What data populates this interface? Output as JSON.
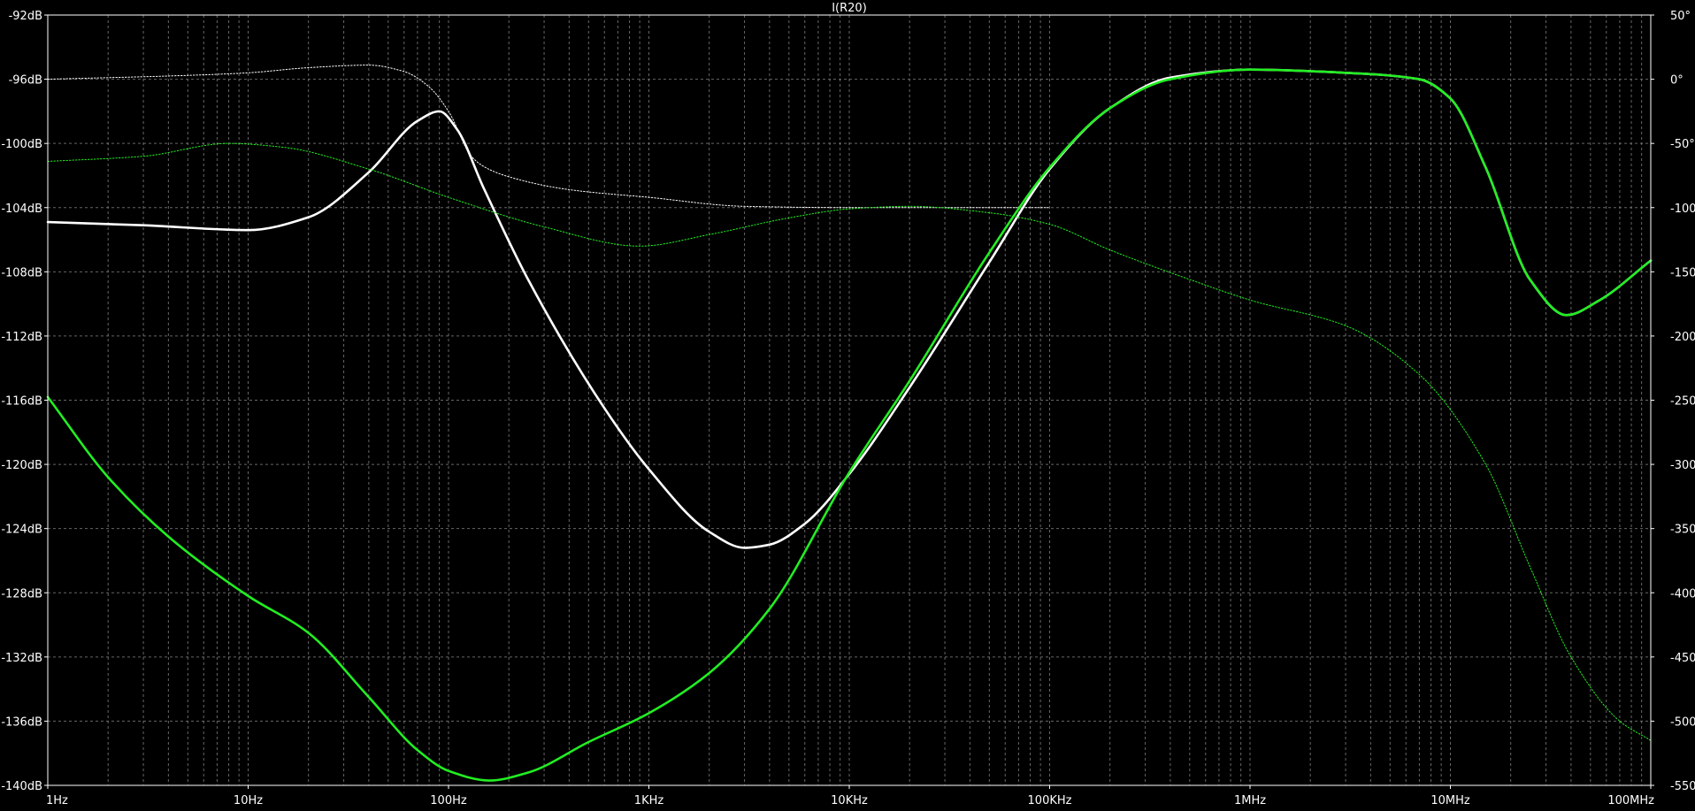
{
  "chart_data": {
    "type": "line",
    "title": "I(R20)",
    "x_scale": "log",
    "x_range_hz": [
      1,
      100000000
    ],
    "x_tick_labels": [
      "1Hz",
      "10Hz",
      "100Hz",
      "1KHz",
      "10KHz",
      "100KHz",
      "1MHz",
      "10MHz",
      "100MHz"
    ],
    "y_left_range_db": [
      -140,
      -92
    ],
    "y_left_tick_labels": [
      "-92dB",
      "-96dB",
      "-100dB",
      "-104dB",
      "-108dB",
      "-112dB",
      "-116dB",
      "-120dB",
      "-124dB",
      "-128dB",
      "-132dB",
      "-136dB",
      "-140dB"
    ],
    "y_right_range_deg": [
      -550,
      50
    ],
    "y_right_tick_labels": [
      "50°",
      "0°",
      "-50°",
      "-100°",
      "-150°",
      "-200°",
      "-250°",
      "-300°",
      "-350°",
      "-400°",
      "-450°",
      "-500°",
      "-550°"
    ],
    "grid": true,
    "colors": {
      "background": "#000000",
      "axis": "#ffffff",
      "grid": "#8a8a8a",
      "white_trace": "#ffffff",
      "green_trace": "#22ee22"
    },
    "series": [
      {
        "color": "#ffffff",
        "style": "solid",
        "axis": "left",
        "unit": "dB",
        "points": [
          [
            1,
            -104.9
          ],
          [
            3,
            -105.1
          ],
          [
            10,
            -105.4
          ],
          [
            20,
            -104.6
          ],
          [
            40,
            -101.8
          ],
          [
            70,
            -98.6
          ],
          [
            90,
            -98.0
          ],
          [
            110,
            -99.1
          ],
          [
            150,
            -102.8
          ],
          [
            250,
            -108.5
          ],
          [
            600,
            -116.5
          ],
          [
            1000,
            -120.3
          ],
          [
            2000,
            -124.2
          ],
          [
            3000,
            -125.2
          ],
          [
            4000,
            -125.0
          ],
          [
            6000,
            -123.7
          ],
          [
            10000,
            -120.6
          ],
          [
            20000,
            -115.2
          ],
          [
            50000,
            -107.4
          ],
          [
            100000,
            -101.6
          ],
          [
            200000,
            -97.8
          ],
          [
            400000,
            -95.9
          ],
          [
            1000000,
            -95.4
          ],
          [
            3000000,
            -95.6
          ],
          [
            7000000,
            -96.0
          ],
          [
            10000000,
            -97.2
          ],
          [
            15000000,
            -101.5
          ],
          [
            25000000,
            -108.5
          ],
          [
            38000000,
            -110.7
          ],
          [
            55000000,
            -109.8
          ],
          [
            100000000,
            -107.3
          ]
        ]
      },
      {
        "color": "#ffffff",
        "style": "dotted",
        "axis": "right",
        "unit": "deg",
        "points": [
          [
            1,
            0
          ],
          [
            5,
            3
          ],
          [
            10,
            5
          ],
          [
            20,
            9
          ],
          [
            40,
            11
          ],
          [
            60,
            6
          ],
          [
            80,
            -6
          ],
          [
            100,
            -25
          ],
          [
            130,
            -60
          ],
          [
            150,
            -68
          ],
          [
            200,
            -76
          ],
          [
            400,
            -86
          ],
          [
            1000,
            -92
          ],
          [
            3000,
            -99
          ],
          [
            10000,
            -100
          ],
          [
            30000,
            -100
          ],
          [
            100000,
            -100
          ]
        ]
      },
      {
        "color": "#22ee22",
        "style": "dotted",
        "axis": "right",
        "unit": "deg",
        "points": [
          [
            1,
            -64
          ],
          [
            3,
            -60
          ],
          [
            8,
            -50
          ],
          [
            15,
            -53
          ],
          [
            40,
            -70
          ],
          [
            100,
            -92
          ],
          [
            300,
            -115
          ],
          [
            900,
            -130
          ],
          [
            2000,
            -121
          ],
          [
            5000,
            -108
          ],
          [
            10000,
            -101
          ],
          [
            20000,
            -99
          ],
          [
            50000,
            -104
          ],
          [
            100000,
            -113
          ],
          [
            200000,
            -133
          ],
          [
            500000,
            -156
          ],
          [
            1000000,
            -172
          ],
          [
            3000000,
            -192
          ],
          [
            7000000,
            -230
          ],
          [
            15000000,
            -300
          ],
          [
            25000000,
            -380
          ],
          [
            40000000,
            -450
          ],
          [
            70000000,
            -500
          ],
          [
            100000000,
            -515
          ]
        ]
      },
      {
        "color": "#22ee22",
        "style": "solid",
        "axis": "left",
        "unit": "dB",
        "points": [
          [
            1,
            -115.8
          ],
          [
            2,
            -120.8
          ],
          [
            4,
            -124.5
          ],
          [
            10,
            -128.2
          ],
          [
            20,
            -130.5
          ],
          [
            40,
            -134.5
          ],
          [
            70,
            -137.8
          ],
          [
            100,
            -139.1
          ],
          [
            160,
            -139.7
          ],
          [
            250,
            -139.2
          ],
          [
            500,
            -137.3
          ],
          [
            1000,
            -135.5
          ],
          [
            2000,
            -133.0
          ],
          [
            4000,
            -129.0
          ],
          [
            10000,
            -120.5
          ],
          [
            20000,
            -114.8
          ],
          [
            50000,
            -106.8
          ],
          [
            100000,
            -101.5
          ],
          [
            200000,
            -97.8
          ],
          [
            400000,
            -96.0
          ],
          [
            1000000,
            -95.4
          ],
          [
            3000000,
            -95.6
          ],
          [
            7000000,
            -96.0
          ],
          [
            10000000,
            -97.2
          ],
          [
            15000000,
            -101.5
          ],
          [
            25000000,
            -108.5
          ],
          [
            38000000,
            -110.7
          ],
          [
            55000000,
            -109.8
          ],
          [
            100000000,
            -107.3
          ]
        ]
      }
    ]
  }
}
